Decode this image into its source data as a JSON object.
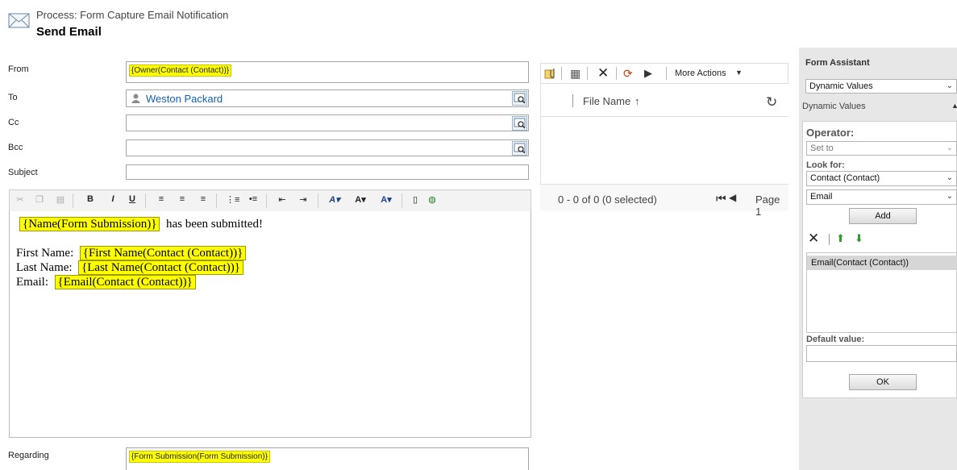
{
  "header": {
    "process_label": "Process: Form Capture Email Notification",
    "title": "Send Email"
  },
  "form": {
    "from_label": "From",
    "from_value": "{Owner(Contact (Contact))}",
    "to_label": "To",
    "to_value": "Weston Packard",
    "cc_label": "Cc",
    "bcc_label": "Bcc",
    "subject_label": "Subject",
    "regarding_label": "Regarding",
    "regarding_value": "{Form Submission(Form Submission)}"
  },
  "editor": {
    "toolbar": {
      "bold": "B",
      "italic": "I",
      "underline": "U"
    },
    "line1_token": "{Name(Form Submission)}",
    "line1_text": "has been submitted!",
    "first_name_label": "First Name:",
    "first_name_token": "{First Name(Contact (Contact))}",
    "last_name_label": "Last Name:",
    "last_name_token": "{Last Name(Contact (Contact))}",
    "email_label": "Email:",
    "email_token": "{Email(Contact (Contact))}"
  },
  "attachments": {
    "more_actions": "More Actions",
    "column_file_name": "File Name",
    "sort_arrow": "↑",
    "status": "0 - 0 of 0 (0 selected)",
    "page_label": "Page 1"
  },
  "form_assistant": {
    "title": "Form Assistant",
    "dropdown_value": "Dynamic Values",
    "section_label": "Dynamic Values",
    "operator_label": "Operator:",
    "operator_value": "Set to",
    "look_for_label": "Look for:",
    "look_for_entity": "Contact (Contact)",
    "look_for_field": "Email",
    "add_label": "Add",
    "selected_item": "Email(Contact (Contact))",
    "default_value_label": "Default value:",
    "ok_label": "OK"
  },
  "colors": {
    "token_highlight": "#ffff00",
    "link": "#1160b7",
    "panel_bg": "#e7e7e7"
  }
}
